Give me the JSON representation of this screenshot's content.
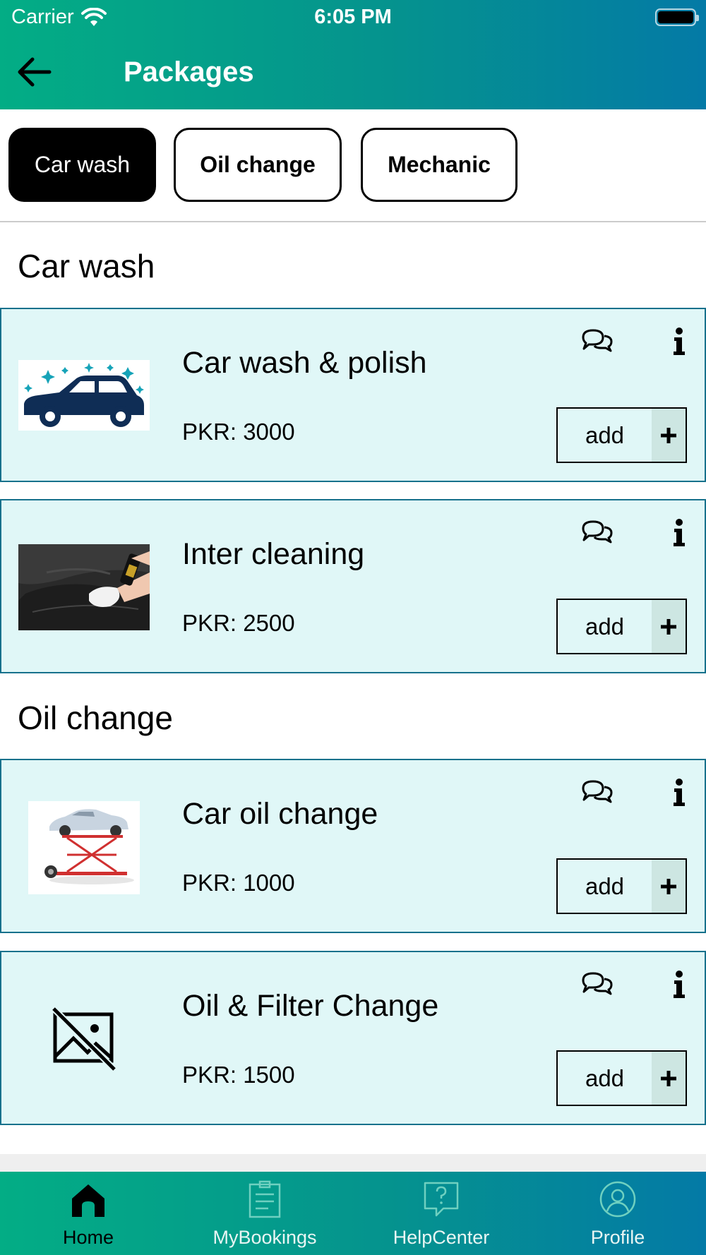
{
  "status_bar": {
    "carrier": "Carrier",
    "time": "6:05 PM"
  },
  "header": {
    "title": "Packages"
  },
  "tabs": [
    {
      "label": "Car wash",
      "active": true
    },
    {
      "label": "Oil change",
      "active": false
    },
    {
      "label": "Mechanic",
      "active": false
    }
  ],
  "sections": [
    {
      "title": "Car wash",
      "packages": [
        {
          "name": "Car wash & polish",
          "price": "PKR: 3000",
          "add_label": "add",
          "image": "car-wash-image"
        },
        {
          "name": "Inter cleaning",
          "price": "PKR: 2500",
          "add_label": "add",
          "image": "interior-cleaning-photo"
        }
      ]
    },
    {
      "title": "Oil change",
      "packages": [
        {
          "name": "Car oil change",
          "price": "PKR: 1000",
          "add_label": "add",
          "image": "car-lift-image"
        },
        {
          "name": "Oil & Filter Change",
          "price": "PKR: 1500",
          "add_label": "add",
          "image": "image-placeholder-icon"
        }
      ]
    }
  ],
  "tabbar": [
    {
      "label": "Home",
      "icon": "home-icon",
      "active": true
    },
    {
      "label": "MyBookings",
      "icon": "clipboard-icon",
      "active": false
    },
    {
      "label": "HelpCenter",
      "icon": "help-bubble-icon",
      "active": false
    },
    {
      "label": "Profile",
      "icon": "user-circle-icon",
      "active": false
    }
  ],
  "colors": {
    "header_start": "#03ad85",
    "header_end": "#047aa6",
    "card_background": "#e0f7f7",
    "card_border": "#17718c",
    "active_tab": "#000000"
  }
}
